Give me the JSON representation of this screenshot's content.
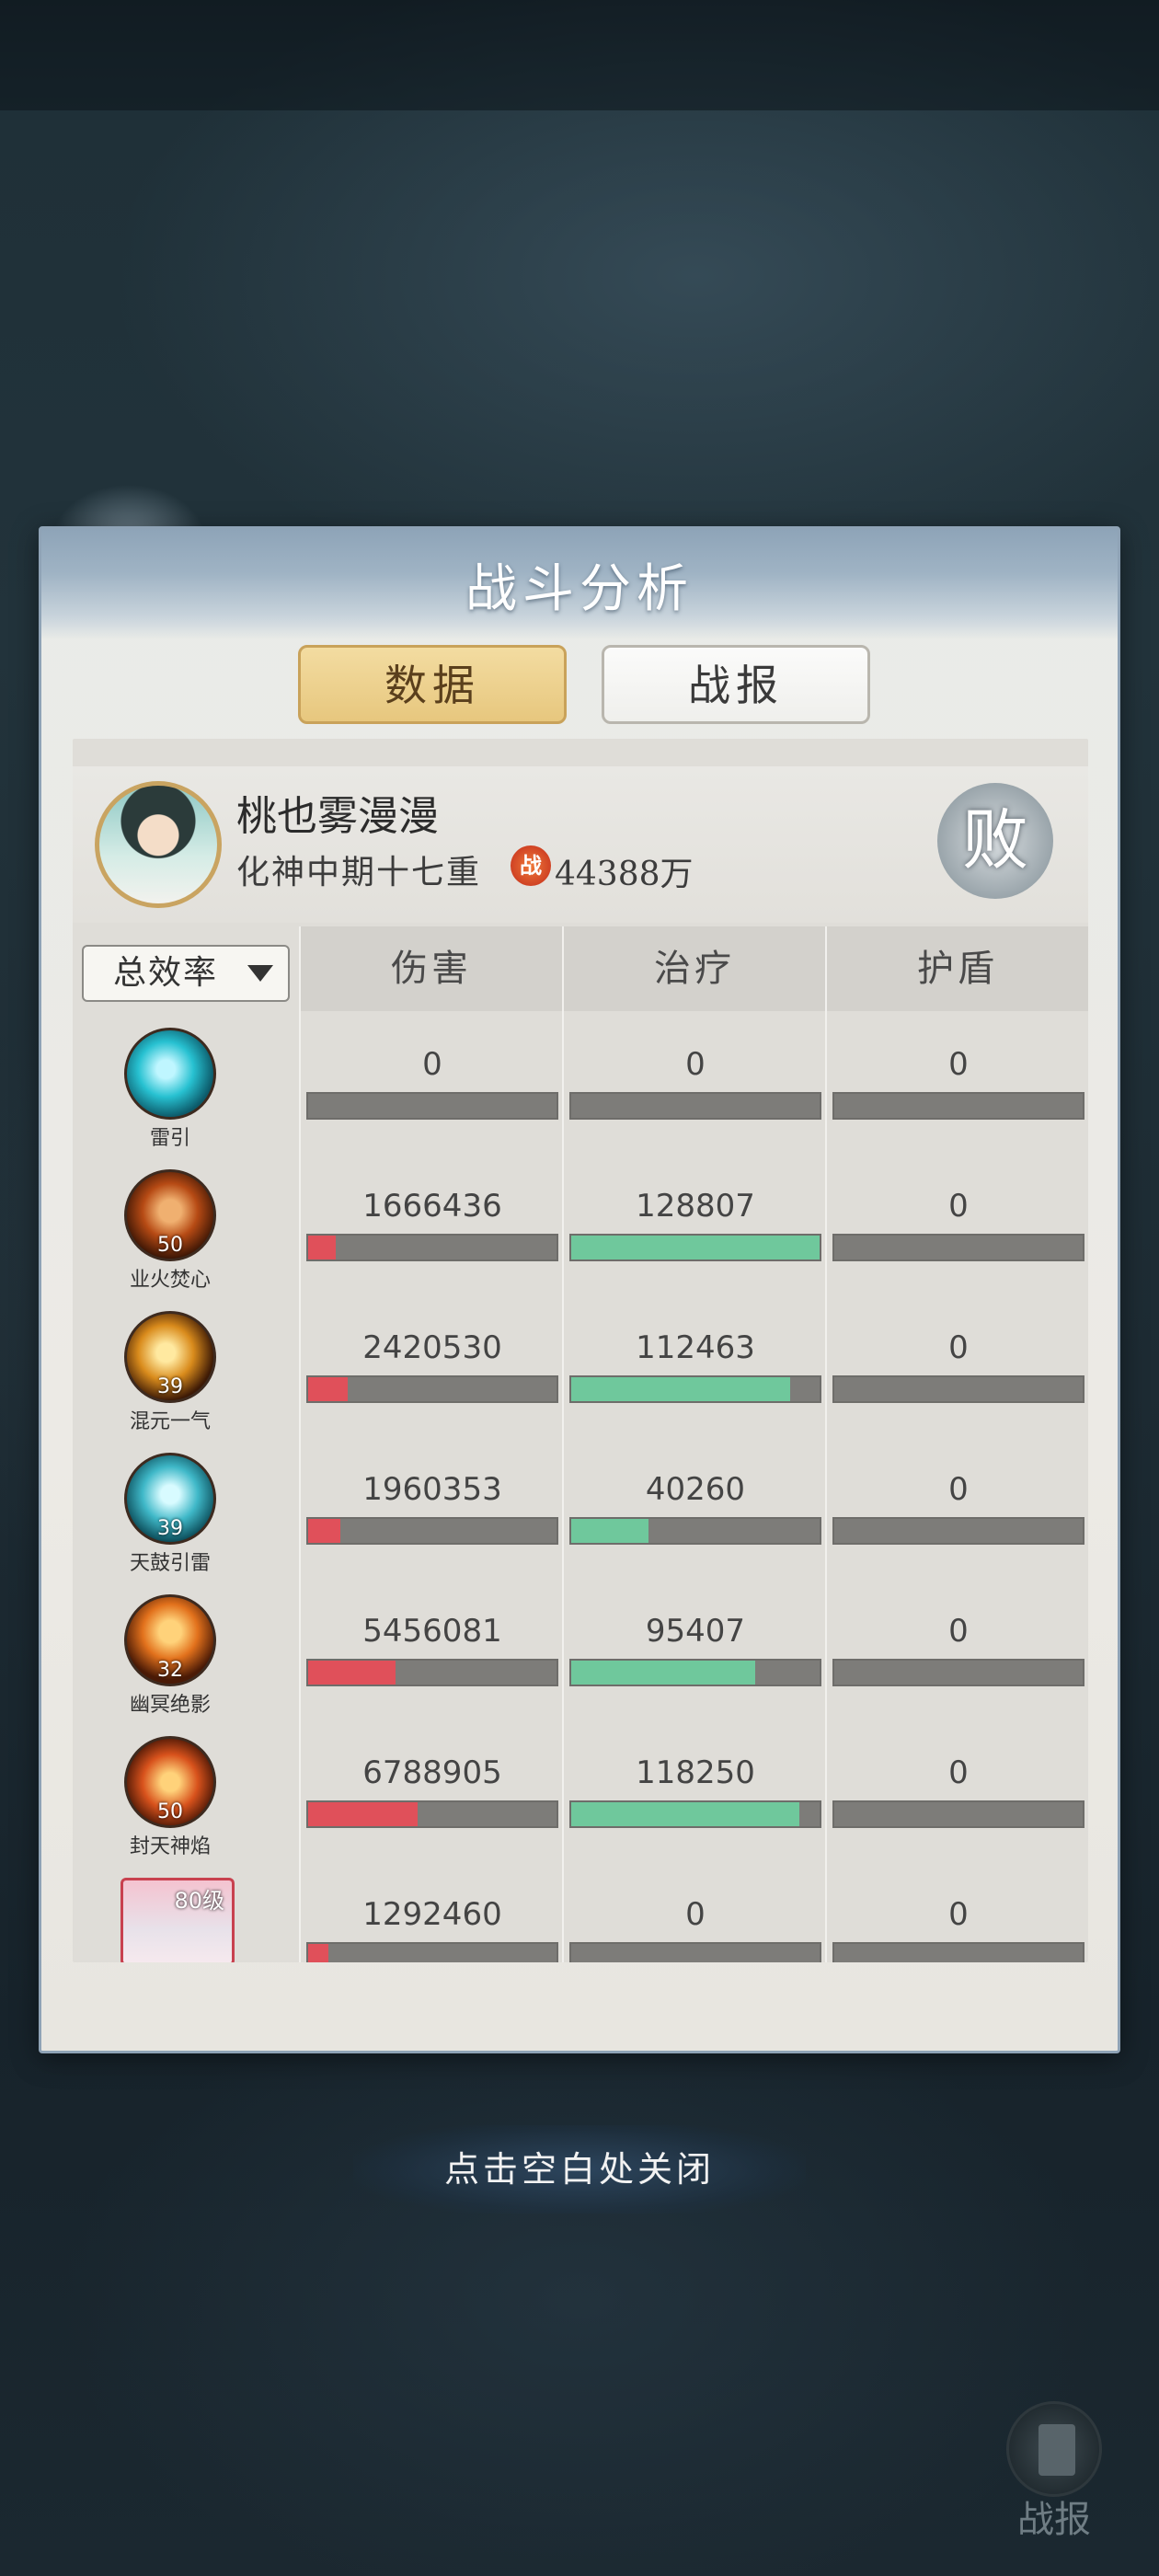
{
  "window": {
    "title": "战斗分析"
  },
  "tabs": [
    {
      "label": "数据",
      "active": true
    },
    {
      "label": "战报",
      "active": false
    }
  ],
  "player": {
    "name": "桃也雾漫漫",
    "realm": "化神中期十七重",
    "power_icon_text": "战",
    "power": "44388万",
    "result": "败"
  },
  "sort": {
    "selected": "总效率"
  },
  "columns": [
    "伤害",
    "治疗",
    "护盾"
  ],
  "colors": {
    "damage_bar": "#e0505a",
    "heal_bar": "#6fc89c",
    "accent": "#e7c77e"
  },
  "rows": [
    {
      "skill": "雷引",
      "level": "",
      "icon": "lightning-orb-icon",
      "damage": "0",
      "heal": "0",
      "shield": "0",
      "damage_pct": 0,
      "heal_pct": 0,
      "shield_pct": 0
    },
    {
      "skill": "业火焚心",
      "level": "50",
      "icon": "fire-heart-icon",
      "damage": "1666436",
      "heal": "128807",
      "shield": "0",
      "damage_pct": 0.11,
      "heal_pct": 1.0,
      "shield_pct": 0
    },
    {
      "skill": "混元一气",
      "level": "39",
      "icon": "golden-qi-icon",
      "damage": "2420530",
      "heal": "112463",
      "shield": "0",
      "damage_pct": 0.16,
      "heal_pct": 0.88,
      "shield_pct": 0
    },
    {
      "skill": "天鼓引雷",
      "level": "39",
      "icon": "thunder-drum-icon",
      "damage": "1960353",
      "heal": "40260",
      "shield": "0",
      "damage_pct": 0.13,
      "heal_pct": 0.31,
      "shield_pct": 0
    },
    {
      "skill": "幽冥绝影",
      "level": "32",
      "icon": "shadow-blade-icon",
      "damage": "5456081",
      "heal": "95407",
      "shield": "0",
      "damage_pct": 0.35,
      "heal_pct": 0.74,
      "shield_pct": 0
    },
    {
      "skill": "封天神焰",
      "level": "50",
      "icon": "divine-flame-icon",
      "damage": "6788905",
      "heal": "118250",
      "shield": "0",
      "damage_pct": 0.44,
      "heal_pct": 0.92,
      "shield_pct": 0
    },
    {
      "skill": "",
      "level": "80级",
      "icon": "pet-portrait-icon",
      "damage": "1292460",
      "heal": "0",
      "shield": "0",
      "damage_pct": 0.08,
      "heal_pct": 0,
      "shield_pct": 0
    }
  ],
  "footer": {
    "close_hint": "点击空白处关闭",
    "report_button": "战报"
  }
}
